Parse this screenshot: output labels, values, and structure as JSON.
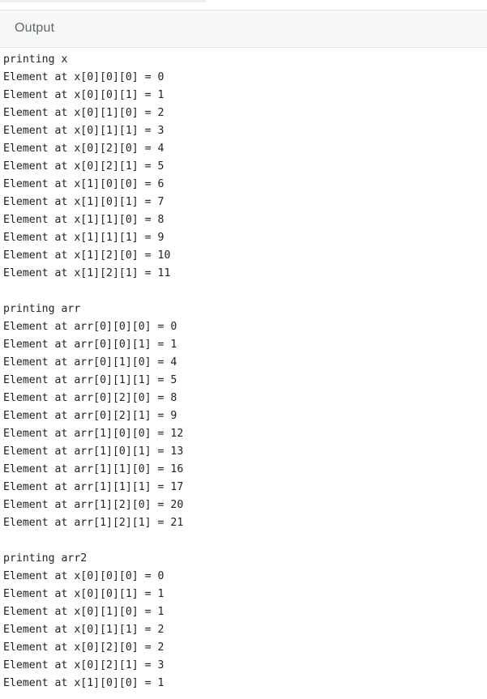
{
  "panel": {
    "title": "Output"
  },
  "output_lines": [
    "printing x",
    "Element at x[0][0][0] = 0",
    "Element at x[0][0][1] = 1",
    "Element at x[0][1][0] = 2",
    "Element at x[0][1][1] = 3",
    "Element at x[0][2][0] = 4",
    "Element at x[0][2][1] = 5",
    "Element at x[1][0][0] = 6",
    "Element at x[1][0][1] = 7",
    "Element at x[1][1][0] = 8",
    "Element at x[1][1][1] = 9",
    "Element at x[1][2][0] = 10",
    "Element at x[1][2][1] = 11",
    "",
    "printing arr",
    "Element at arr[0][0][0] = 0",
    "Element at arr[0][0][1] = 1",
    "Element at arr[0][1][0] = 4",
    "Element at arr[0][1][1] = 5",
    "Element at arr[0][2][0] = 8",
    "Element at arr[0][2][1] = 9",
    "Element at arr[1][0][0] = 12",
    "Element at arr[1][0][1] = 13",
    "Element at arr[1][1][0] = 16",
    "Element at arr[1][1][1] = 17",
    "Element at arr[1][2][0] = 20",
    "Element at arr[1][2][1] = 21",
    "",
    "printing arr2",
    "Element at x[0][0][0] = 0",
    "Element at x[0][0][1] = 1",
    "Element at x[0][1][0] = 1",
    "Element at x[0][1][1] = 2",
    "Element at x[0][2][0] = 2",
    "Element at x[0][2][1] = 3",
    "Element at x[1][0][0] = 1"
  ]
}
